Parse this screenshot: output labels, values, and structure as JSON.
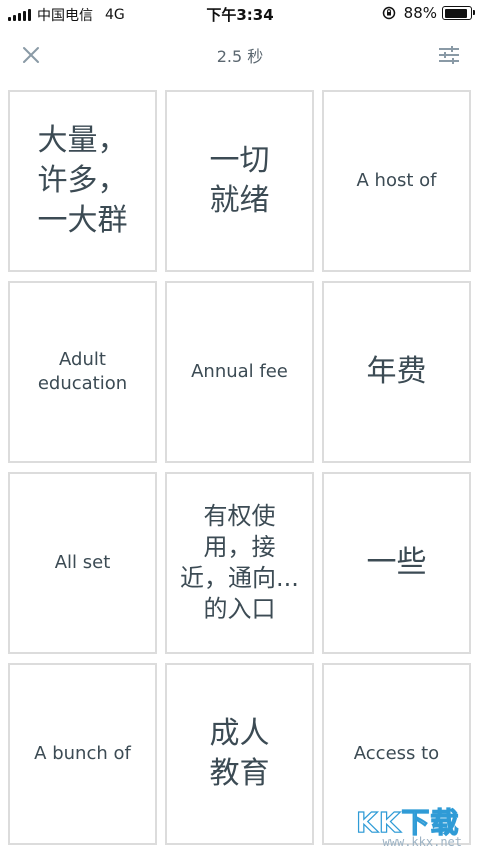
{
  "status_bar": {
    "carrier": "中国电信",
    "network": "4G",
    "time": "下午3:34",
    "battery_percent": "88%",
    "battery_level": 0.88
  },
  "header": {
    "timer": "2.5 秒",
    "close_icon": "close-icon",
    "settings_icon": "sliders-icon"
  },
  "tiles": [
    {
      "text": "大量，\n许多，\n一大群",
      "kind": "zh"
    },
    {
      "text": "一切\n就绪",
      "kind": "zh"
    },
    {
      "text": "A host of",
      "kind": "term"
    },
    {
      "text": "Adult\neducation",
      "kind": "term"
    },
    {
      "text": "Annual fee",
      "kind": "term"
    },
    {
      "text": "年费",
      "kind": "zh"
    },
    {
      "text": "All set",
      "kind": "term"
    },
    {
      "text": "有权使\n用，接\n近，通向...\n的入口",
      "kind": "zh-small"
    },
    {
      "text": "一些",
      "kind": "zh"
    },
    {
      "text": "A bunch of",
      "kind": "term"
    },
    {
      "text": "成人\n教育",
      "kind": "zh"
    },
    {
      "text": "Access to",
      "kind": "term"
    }
  ],
  "watermark": {
    "logo": "KK下载",
    "url": "www.kkx.net"
  },
  "colors": {
    "text": "#3c4b54",
    "tile_border": "#dcdcdc",
    "icon": "#8a9aa6"
  }
}
